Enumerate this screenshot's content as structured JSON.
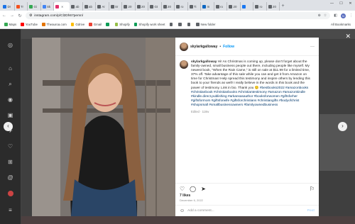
{
  "browser": {
    "tabs": [
      {
        "label": "Dr",
        "color": "#1a73e8"
      },
      {
        "label": "Tr",
        "color": "#f4511e"
      },
      {
        "label": "Gi",
        "color": "#34a853"
      },
      {
        "label": "Sk",
        "color": "#4285f4"
      },
      {
        "label": "",
        "color": "#e1306c",
        "active": true
      },
      {
        "label": "ab",
        "color": "#5f6368"
      },
      {
        "label": "ab",
        "color": "#5f6368"
      },
      {
        "label": "Ar",
        "color": "#5f6368"
      },
      {
        "label": "Sr",
        "color": "#5f6368"
      },
      {
        "label": "20",
        "color": "#5f6368"
      },
      {
        "label": "20",
        "color": "#5f6368"
      },
      {
        "label": "Gt",
        "color": "#5f6368"
      },
      {
        "label": "20",
        "color": "#5f6368"
      },
      {
        "label": "ro",
        "color": "#5f6368"
      },
      {
        "label": "Ti",
        "color": "#5f6368"
      },
      {
        "label": "In",
        "color": "#0a66c2"
      },
      {
        "label": "ro",
        "color": "#5f6368"
      },
      {
        "label": "20",
        "color": "#5f6368"
      },
      {
        "label": "",
        "color": "#1877f2"
      },
      {
        "label": "ro",
        "color": "#5f6368"
      },
      {
        "label": "20",
        "color": "#5f6368"
      }
    ],
    "new_tab": "+",
    "url": "instagram.com/p/Cl2Dh67pemn/",
    "profile_initial": "N",
    "bookmarks": [
      {
        "label": "Maps",
        "color": "#34a853"
      },
      {
        "label": "YouTube",
        "color": "#ff0000"
      },
      {
        "label": "Theauroa.com",
        "color": "#e37400"
      },
      {
        "label": "Gdrive",
        "color": "#fbbc04"
      },
      {
        "label": "Gmail",
        "color": "#ea4335"
      },
      {
        "label": "",
        "color": "#0f9d58"
      },
      {
        "label": "Shopify",
        "color": "#95bf47"
      },
      {
        "label": "Shopify work sheet",
        "color": "#0f9d58"
      },
      {
        "label": "",
        "color": "#5f6368"
      },
      {
        "label": "",
        "color": "#5f6368"
      },
      {
        "label": "",
        "color": "#5f6368"
      },
      {
        "label": "New folder",
        "color": "#5f6368"
      }
    ],
    "all_bookmarks": "All Bookmarks"
  },
  "post": {
    "username": "skylarkgalloway",
    "follow": "Follow",
    "caption_text": "Hi! As Christmas is coming up, please don't forget about the family-owned, small business people out there, including people like myself. My newest book, \"When the Rain Came,\" is still on sale at $11.99 for a limited time, 37% off. Take advantage of this sale while you can and get it from Amazon on time for Christmas! Help spread this testimony and inspire others by lending this book to your friends as well! I really believe in the words in this book and the power of testimony. Link in bio. Thank you",
    "hashtags": "#bestbooks2022 #amazonbooks #christianbook #christianbooks #christiantestimony #amazon #amazonkindle #kindle.direct.publishing #arkansasauthor #booksforwomen #giftsforher #giftsformom #giftsforwife #giftsforchristians #christiangifts #bodyofchrist #shopsmall #smallbusinessowners #familyownedbusiness",
    "edited": "Edited · 118w",
    "likes": "7 likes",
    "date": "December 6, 2022",
    "comment_placeholder": "Add a comment...",
    "post_button": "Post"
  },
  "colors": {
    "follow": "#0095f6",
    "hashtag": "#00376b",
    "overlay": "#3f3f3f"
  }
}
